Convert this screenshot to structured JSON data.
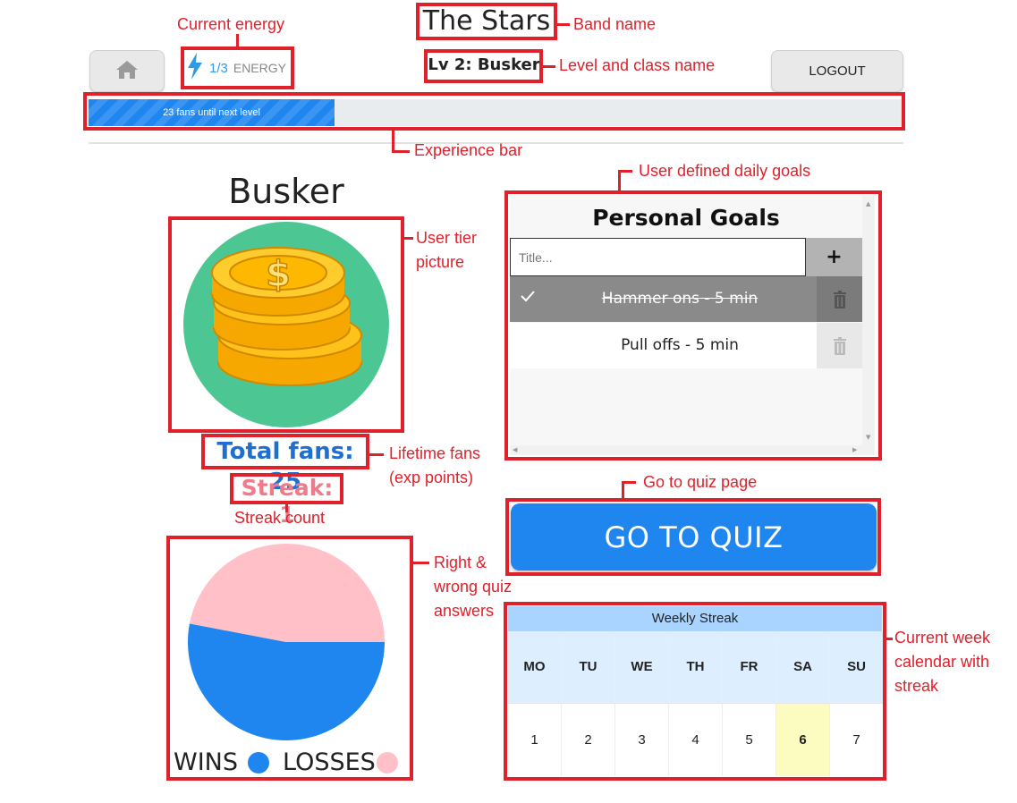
{
  "header": {
    "band_name": "The Stars",
    "level_label": "Lv 2: Busker",
    "logout_label": "LOGOUT",
    "home_icon": "home-icon",
    "energy": {
      "value": "1/3",
      "label": "ENERGY",
      "icon": "lightning-icon"
    }
  },
  "experience": {
    "label": "23 fans until next level",
    "progress_fraction": 0.302
  },
  "profile": {
    "tier_name": "Busker",
    "tier_icon": "coins-icon",
    "total_fans": "Total fans: 25",
    "streak": "Streak: 1"
  },
  "goals": {
    "title": "Personal Goals",
    "placeholder": "Title...",
    "add_label": "+",
    "items": [
      {
        "text": "Hammer ons - 5 min",
        "done": true
      },
      {
        "text": "Pull offs - 5 min",
        "done": false
      }
    ]
  },
  "quiz": {
    "button_label": "GO TO QUIZ"
  },
  "calendar": {
    "title": "Weekly Streak",
    "days": [
      "MO",
      "TU",
      "WE",
      "TH",
      "FR",
      "SA",
      "SU"
    ],
    "dates": [
      "1",
      "2",
      "3",
      "4",
      "5",
      "6",
      "7"
    ],
    "highlighted_index": 5
  },
  "chart_data": {
    "type": "pie",
    "title": "",
    "slices": [
      {
        "name": "WINS",
        "value": 53,
        "color": "#1f86f0"
      },
      {
        "name": "LOSSES",
        "value": 47,
        "color": "#ffc0c8"
      }
    ],
    "legend": [
      "WINS",
      "LOSSES"
    ],
    "legend_position": "bottom"
  },
  "annotations": {
    "current_energy": "Current energy",
    "band_name": "Band name",
    "level_class": "Level and class name",
    "experience_bar": "Experience bar",
    "daily_goals": "User defined daily goals",
    "tier_picture": "User tier\npicture",
    "lifetime_fans": "Lifetime fans\n(exp points)",
    "streak_count": "Streak count",
    "quiz_page": "Go to quiz page",
    "quiz_answers": "Right &\nwrong quiz\nanswers",
    "week_calendar": "Current week\ncalendar with\nstreak"
  },
  "colors": {
    "accent": "#1f86f0",
    "annotation_red": "#e0202b",
    "streak_pink": "#f07a8a",
    "calendar_highlight": "#fdfcc0"
  }
}
